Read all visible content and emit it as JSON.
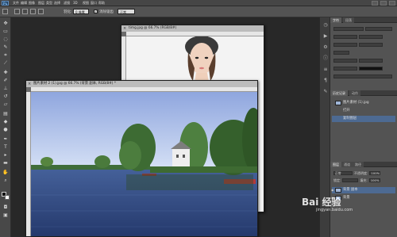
{
  "app": {
    "logo": "Ps",
    "menu": [
      "文件",
      "编辑",
      "图像",
      "图层",
      "类型",
      "选择",
      "滤镜",
      "3D",
      "视图",
      "窗口",
      "帮助"
    ]
  },
  "options": {
    "feather_label": "羽化:",
    "feather_value": "0 像素",
    "antialias_label": "消除锯齿",
    "style_value": "正常"
  },
  "doc1": {
    "title": "timg.jpg @ 66.7% (RGB/8#)"
  },
  "doc2": {
    "title": "图片素材 2 (1).jpg @ 66.7% (背景 副本, RGB/8#) *"
  },
  "panels": {
    "tabs_top": [
      "字符",
      "段落"
    ],
    "tabs_mid": [
      "颜色",
      "色板"
    ],
    "tabs_history": [
      "历史记录",
      "动作"
    ],
    "history_items": [
      "图片素材 (1).jpg",
      "打开",
      "复制图层"
    ],
    "tabs_layers": [
      "图层",
      "通道",
      "路径"
    ],
    "blend_mode": "正常",
    "opacity_label": "不透明度:",
    "opacity_value": "100%",
    "lock_label": "锁定:",
    "fill_label": "填充:",
    "fill_value": "100%",
    "layers": [
      {
        "name": "背景 副本",
        "selected": true
      },
      {
        "name": "背景",
        "selected": false
      }
    ]
  },
  "watermark": {
    "brand": "Bai 经验",
    "domain": "jingyan.baidu.com"
  },
  "colors": {
    "workspace": "#282828",
    "selection": "#4d6a92"
  }
}
